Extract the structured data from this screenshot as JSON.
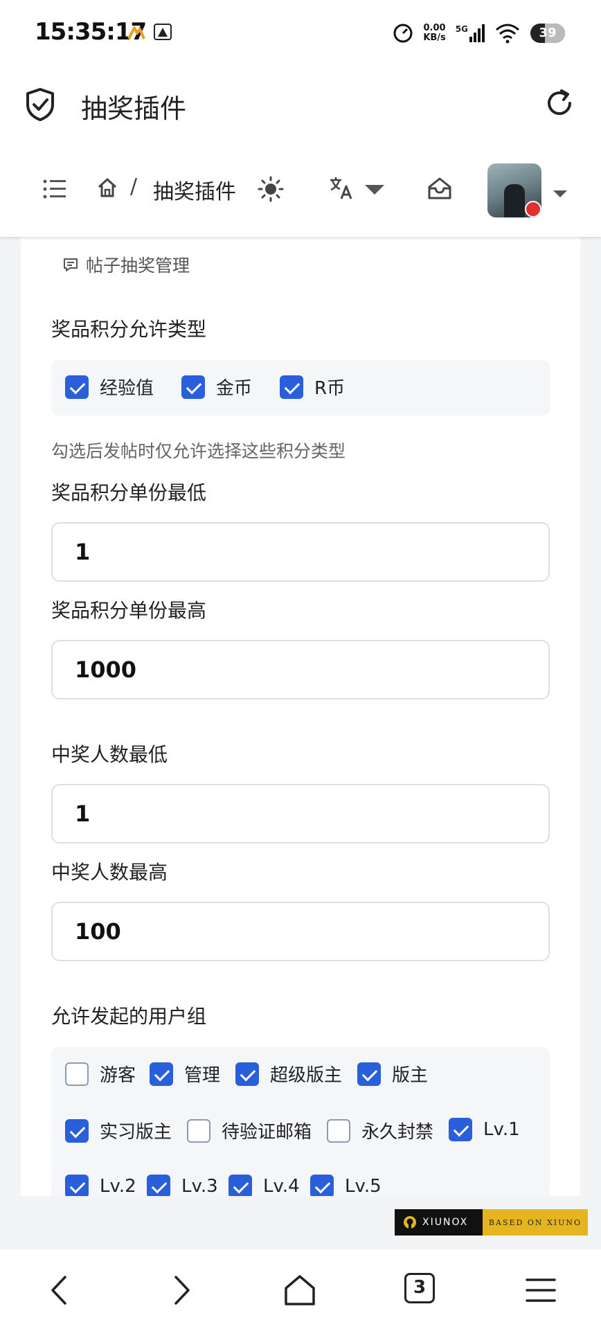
{
  "status_bar": {
    "time": "15:35:17",
    "net_speed_value": "0.00",
    "net_speed_unit": "KB/s",
    "network": "5G",
    "battery": "39"
  },
  "app_bar": {
    "title": "抽奖插件"
  },
  "site_nav": {
    "separator": "/",
    "breadcrumb": "抽奖插件"
  },
  "card": {
    "title": "帖子抽奖管理",
    "credit_types": {
      "label": "奖品积分允许类型",
      "options": [
        {
          "label": "经验值",
          "checked": true
        },
        {
          "label": "金币",
          "checked": true
        },
        {
          "label": "R币",
          "checked": true
        }
      ],
      "hint": "勾选后发帖时仅允许选择这些积分类型"
    },
    "min_per_share": {
      "label": "奖品积分单份最低",
      "value": "1"
    },
    "max_per_share": {
      "label": "奖品积分单份最高",
      "value": "1000"
    },
    "min_winners": {
      "label": "中奖人数最低",
      "value": "1"
    },
    "max_winners": {
      "label": "中奖人数最高",
      "value": "100"
    },
    "user_groups": {
      "label": "允许发起的用户组",
      "options": [
        {
          "label": "游客",
          "checked": false
        },
        {
          "label": "管理",
          "checked": true
        },
        {
          "label": "超级版主",
          "checked": true
        },
        {
          "label": "版主",
          "checked": true
        },
        {
          "label": "实习版主",
          "checked": true
        },
        {
          "label": "待验证邮箱",
          "checked": false
        },
        {
          "label": "永久封禁",
          "checked": false
        },
        {
          "label": "Lv.1",
          "checked": true
        },
        {
          "label": "Lv.2",
          "checked": true
        },
        {
          "label": "Lv.3",
          "checked": true
        },
        {
          "label": "Lv.4",
          "checked": true
        },
        {
          "label": "Lv.5",
          "checked": true
        }
      ]
    }
  },
  "footer": {
    "left": "XIUNOX",
    "right": "BASED ON XIUNO"
  },
  "bottom_bar": {
    "tab_count": "3"
  },
  "colors": {
    "accent": "#2a5fdc",
    "footer_gold": "#e5b520"
  }
}
